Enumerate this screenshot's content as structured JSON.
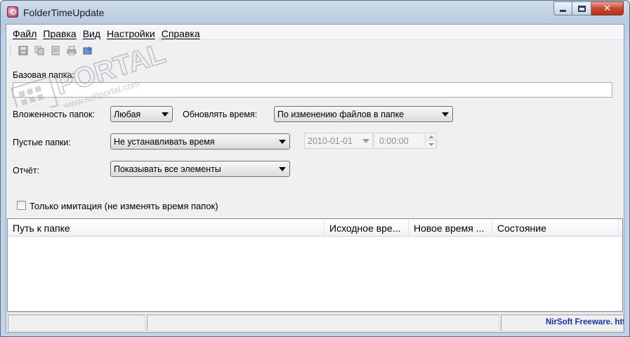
{
  "window": {
    "title": "FolderTimeUpdate",
    "close_glyph": "✕"
  },
  "menu": {
    "items": [
      "Файл",
      "Правка",
      "Вид",
      "Настройки",
      "Справка"
    ]
  },
  "toolbar": {
    "icons": [
      "save-icon",
      "copy-icon",
      "properties-icon",
      "print-icon",
      "run-icon"
    ]
  },
  "form": {
    "base_folder_label": "Базовая папка:",
    "base_folder_value": "",
    "depth_label": "Вложенность папок:",
    "depth_value": "Любая",
    "update_time_label": "Обновлять время:",
    "update_time_value": "По изменению файлов в папке",
    "empty_folders_label": "Пустые папки:",
    "empty_folders_value": "Не устанавливать время",
    "date_value": "2010-01-01",
    "time_value": "0:00:00",
    "report_label": "Отчёт:",
    "report_value": "Показывать все элементы",
    "simulation_label": "Только имитация (не изменять время папок)",
    "simulation_checked": false
  },
  "table": {
    "columns": [
      "Путь к папке",
      "Исходное вре...",
      "Новое время ...",
      "Состояние"
    ],
    "rows": []
  },
  "status": {
    "link": "NirSoft Freeware.  http://www.nirsoft.net"
  },
  "watermark": {
    "brand": "PORTAL",
    "url": "www.softportal.com",
    "tm": "TM"
  },
  "colors": {
    "status_link": "#1032b4",
    "close_button": "#c9462f"
  }
}
